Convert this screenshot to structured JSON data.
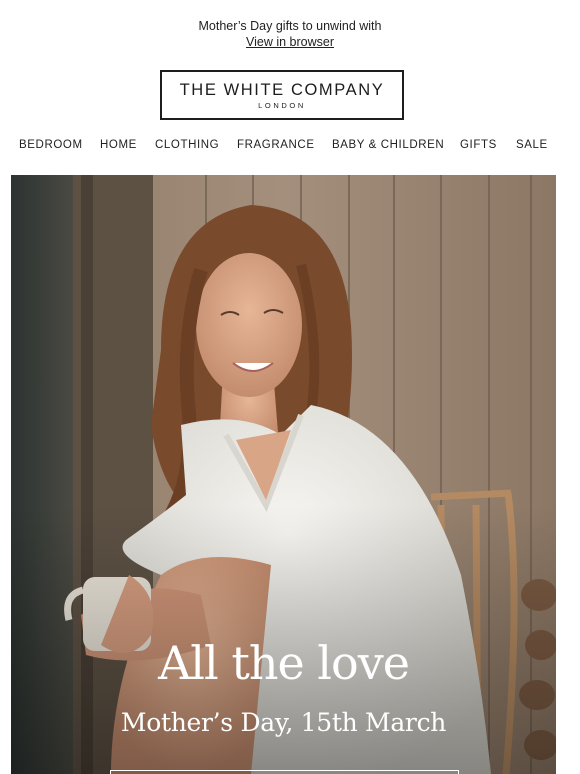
{
  "preheader": {
    "text": "Mother’s Day gifts to unwind with",
    "view_link": "View in browser"
  },
  "logo": {
    "brand": "THE WHITE COMPANY",
    "city": "LONDON"
  },
  "nav": {
    "items": [
      {
        "label": "BEDROOM"
      },
      {
        "label": "HOME"
      },
      {
        "label": "CLOTHING"
      },
      {
        "label": "FRAGRANCE"
      },
      {
        "label": "BABY & CHILDREN"
      },
      {
        "label": "GIFTS"
      },
      {
        "label": "SALE"
      }
    ]
  },
  "hero": {
    "headline": "All the love",
    "subheadline": "Mother’s Day, 15th March"
  },
  "colors": {
    "text": "#222222",
    "wood": "#9b8672",
    "robe": "#eeeeea",
    "skin": "#d9a587"
  }
}
